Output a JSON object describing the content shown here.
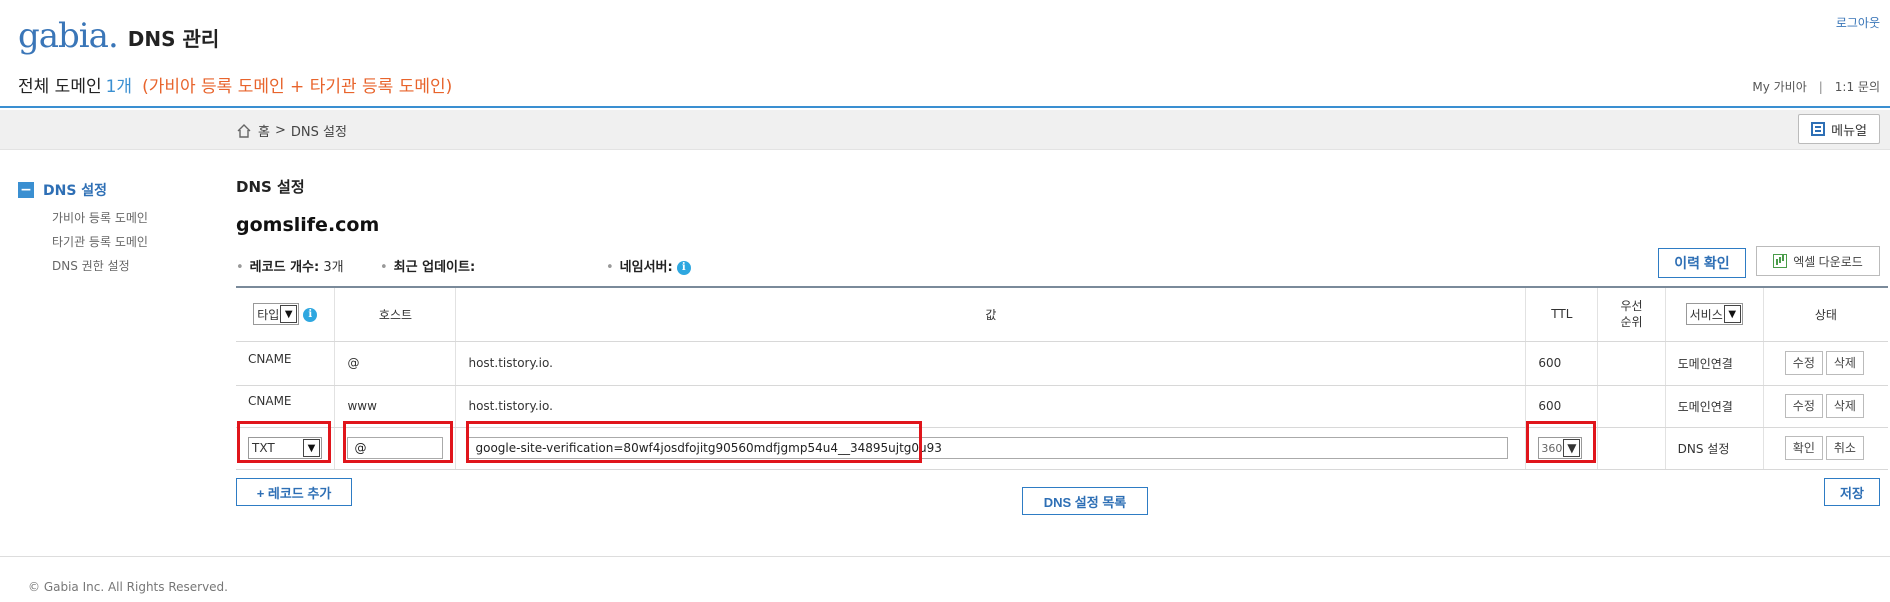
{
  "header": {
    "logo_text": "gabia",
    "title": "DNS 관리",
    "summary_label": "전체 도메인",
    "summary_count": "1개",
    "summary_note": "(가비아 등록 도메인 + 타기관 등록 도메인)",
    "logout": "로그아웃",
    "my_gabia": "My 가비아",
    "separator": "|",
    "inquiry": "1:1 문의"
  },
  "breadcrumb": {
    "home": "홈",
    "sep": ">",
    "current": "DNS 설정",
    "manual_button": "메뉴얼"
  },
  "sidebar": {
    "head": "DNS 설정",
    "items": [
      {
        "label": "가비아 등록 도메인"
      },
      {
        "label": "타기관 등록 도메인"
      },
      {
        "label": "DNS 권한 설정"
      }
    ]
  },
  "content": {
    "section_title": "DNS 설정",
    "domain": "gomslife.com",
    "record_count_label": "레코드 개수:",
    "record_count_value": "3개",
    "last_update_label": "최근 업데이트:",
    "nameserver_label": "네임서버:",
    "history_button": "이력 확인",
    "excel_button": "엑셀 다운로드"
  },
  "table": {
    "headers": {
      "type": "타입",
      "host": "호스트",
      "value": "값",
      "ttl": "TTL",
      "priority": "우선 순위",
      "service": "서비스",
      "status": "상태"
    },
    "rows": [
      {
        "type": "CNAME",
        "host": "@",
        "value": "host.tistory.io.",
        "ttl": "600",
        "priority": "",
        "service": "도메인연결",
        "btn1": "수정",
        "btn2": "삭제"
      },
      {
        "type": "CNAME",
        "host": "www",
        "value": "host.tistory.io.",
        "ttl": "600",
        "priority": "",
        "service": "도메인연결",
        "btn1": "수정",
        "btn2": "삭제"
      }
    ],
    "edit_row": {
      "type": "TXT",
      "host": "@",
      "value": "google-site-verification=80wf4josdfojitg90560mdfjgmp54u4__34895ujtg0u93",
      "ttl": "360",
      "service": "DNS 설정",
      "btn1": "확인",
      "btn2": "취소"
    }
  },
  "actions": {
    "add_record": "+ 레코드 추가",
    "dns_list": "DNS 설정 목록",
    "save": "저장"
  },
  "footer": {
    "copyright": "© Gabia Inc. All Rights Reserved."
  },
  "colors": {
    "accent": "#2e6fb5",
    "orange": "#e8642c",
    "highlight": "#e0151b"
  }
}
